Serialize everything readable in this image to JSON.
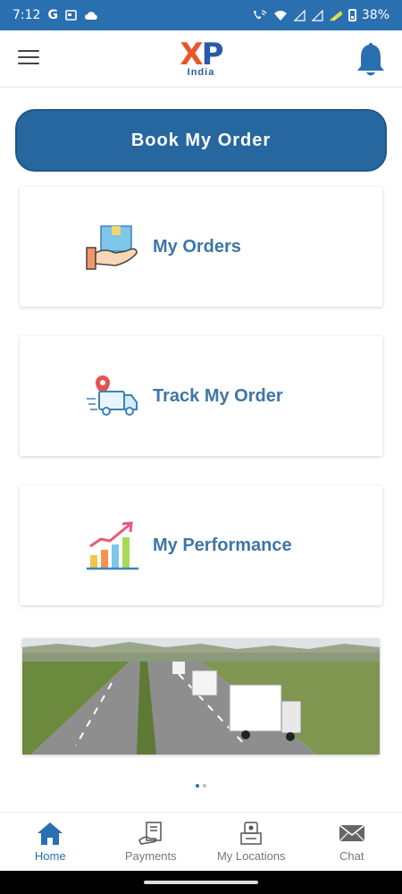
{
  "status_bar": {
    "time": "7:12",
    "g_label": "G",
    "battery": "38%"
  },
  "header": {
    "logo_xp_x": "X",
    "logo_xp_p": "P",
    "logo_sub": "India"
  },
  "book_button": {
    "label": "Book My Order"
  },
  "cards": [
    {
      "label": "My Orders",
      "icon": "box-in-hand-icon"
    },
    {
      "label": "Track My Order",
      "icon": "delivery-truck-location-icon"
    },
    {
      "label": "My Performance",
      "icon": "growth-chart-icon"
    }
  ],
  "carousel": {
    "total": 2,
    "active": 1
  },
  "bottom_nav": [
    {
      "label": "Home",
      "icon": "home-icon",
      "active": true
    },
    {
      "label": "Payments",
      "icon": "payments-icon",
      "active": false
    },
    {
      "label": "My Locations",
      "icon": "locations-icon",
      "active": false
    },
    {
      "label": "Chat",
      "icon": "mail-icon",
      "active": false
    }
  ],
  "colors": {
    "primary": "#2a6fb0",
    "button": "#2767a0",
    "card_label": "#3d76a8",
    "logo_orange": "#e8562a"
  }
}
